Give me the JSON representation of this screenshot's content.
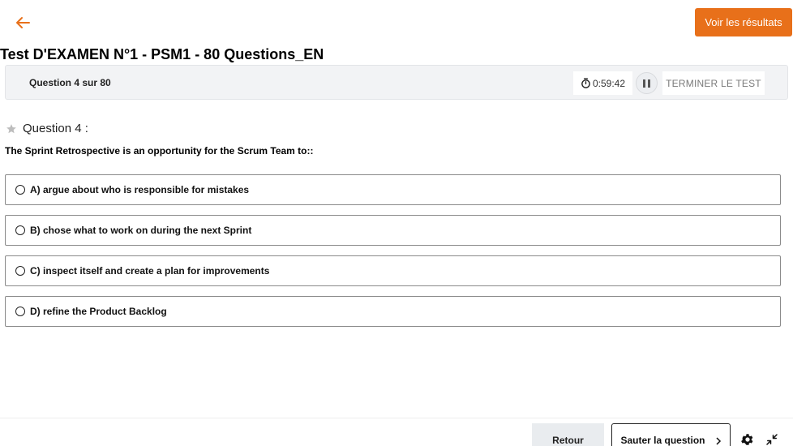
{
  "header": {
    "back_icon": "arrow-left-icon",
    "results_label": "Voir les résultats",
    "accent_color": "#e8701a"
  },
  "exam": {
    "title": "Test D'EXAMEN N°1 - PSM1 - 80 Questions_EN"
  },
  "status": {
    "counter": "Question 4 sur 80",
    "timer": "0:59:42",
    "finish_label": "TERMINER LE TEST"
  },
  "question": {
    "label": "Question 4 :",
    "text": "The Sprint Retrospective is an opportunity for the Scrum Team to::",
    "options": [
      "A) argue about who is responsible for mistakes",
      "B) chose what to work on during the next Sprint",
      "C) inspect itself and create a plan for improvements",
      "D) refine the Product Backlog"
    ]
  },
  "footer": {
    "back_label": "Retour",
    "skip_label": "Sauter la question"
  }
}
